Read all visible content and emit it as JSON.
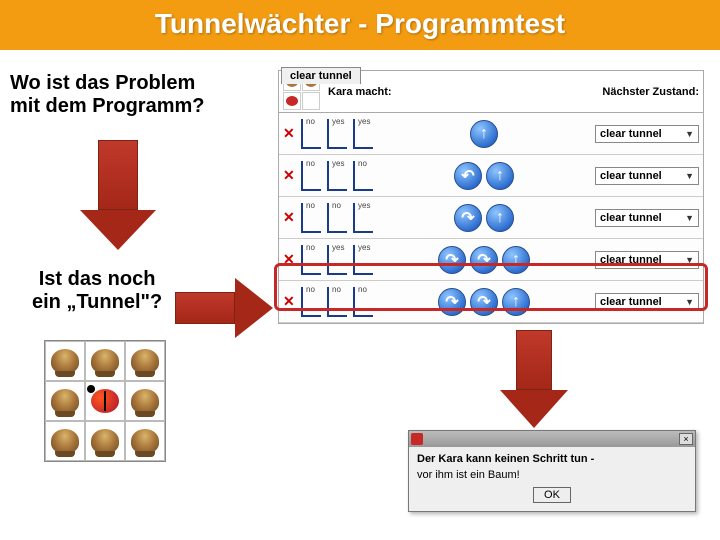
{
  "title": "Tunnelwächter - Programmtest",
  "question1": "Wo ist das Problem\nmit dem Programm?",
  "question2": "Ist das noch\nein „Tunnel\"?",
  "tab_label": "clear tunnel",
  "header": {
    "kara_macht": "Kara macht:",
    "next_state": "Nächster Zustand:"
  },
  "sensor_labels": {
    "yes": "yes",
    "no": "no"
  },
  "rows": [
    {
      "s1": "no",
      "s2": "yes",
      "s3": "yes",
      "actions": [
        "up"
      ],
      "next": "clear tunnel"
    },
    {
      "s1": "no",
      "s2": "yes",
      "s3": "no",
      "actions": [
        "turn-left",
        "up"
      ],
      "next": "clear tunnel"
    },
    {
      "s1": "no",
      "s2": "no",
      "s3": "yes",
      "actions": [
        "turn-right",
        "up"
      ],
      "next": "clear tunnel"
    },
    {
      "s1": "no",
      "s2": "yes",
      "s3": "yes",
      "actions": [
        "turn-right",
        "turn-right",
        "up"
      ],
      "next": "clear tunnel"
    },
    {
      "s1": "no",
      "s2": "no",
      "s3": "no",
      "actions": [
        "turn-right",
        "turn-right",
        "up"
      ],
      "next": "clear tunnel"
    }
  ],
  "highlighted_row_index": 3,
  "action_glyphs": {
    "up": "↑",
    "turn-left": "↶",
    "turn-right": "↷"
  },
  "world": {
    "cells": [
      [
        "stump",
        "stump",
        "stump"
      ],
      [
        "stump",
        "kara",
        "stump"
      ],
      [
        "stump",
        "stump",
        "stump"
      ]
    ]
  },
  "dialog": {
    "line1": "Der Kara kann keinen Schritt tun -",
    "line2": "vor ihm ist ein Baum!",
    "ok": "OK",
    "close": "×"
  }
}
